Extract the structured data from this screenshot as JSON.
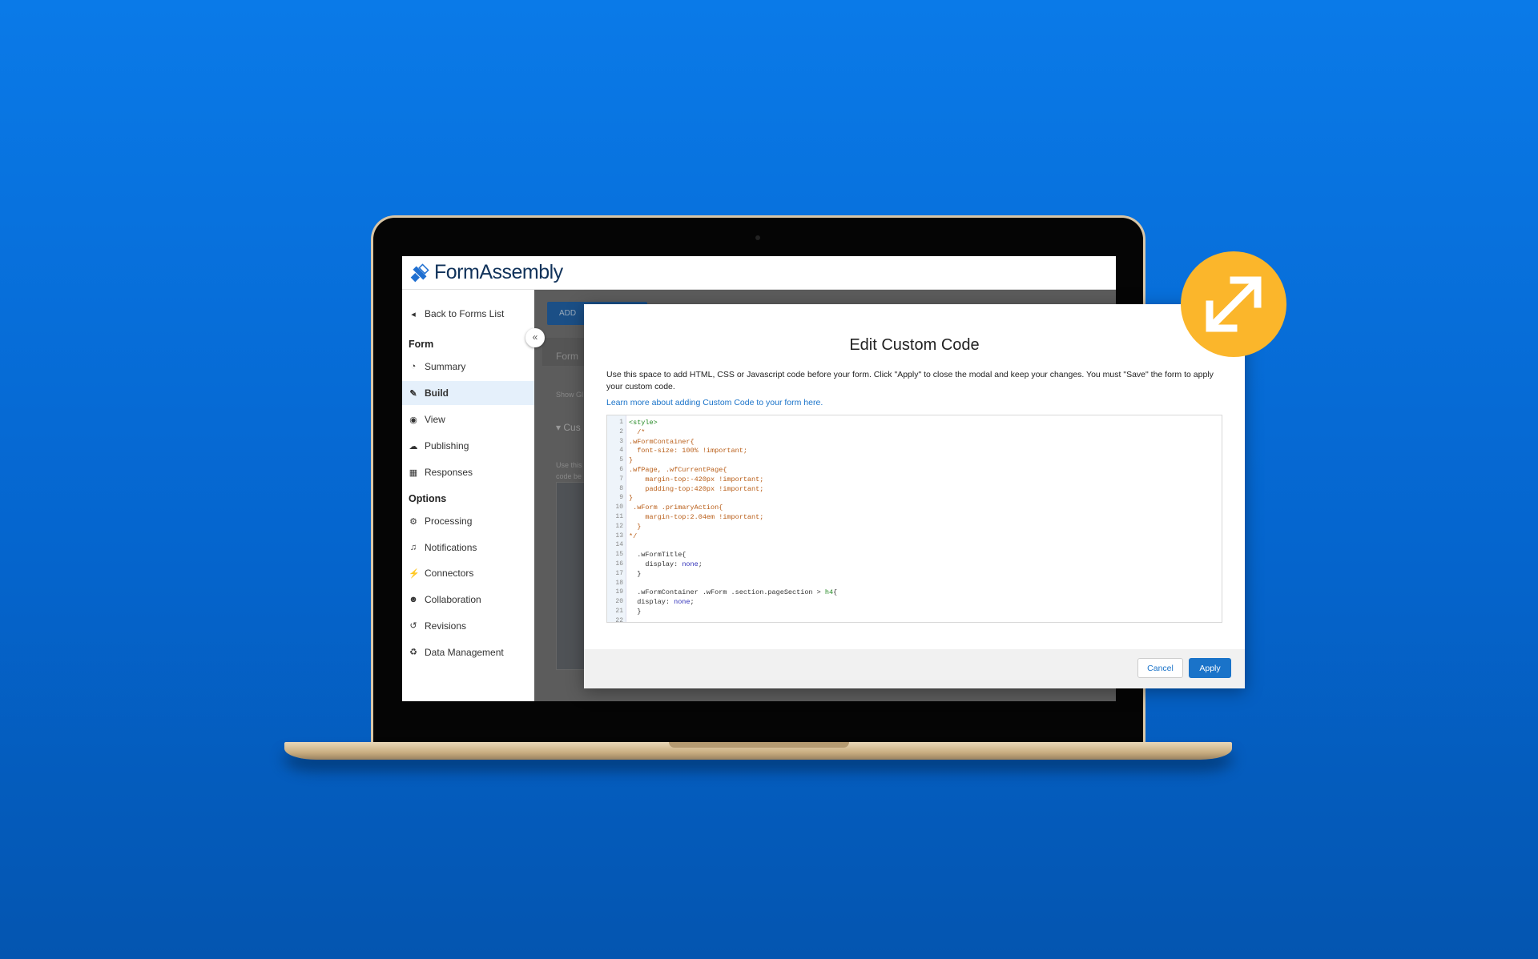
{
  "app": {
    "logo": "FormAssembly"
  },
  "sidebar": {
    "back": "Back to Forms List",
    "form_heading": "Form",
    "form_items": [
      {
        "label": "Summary",
        "icon": "dashboard-icon"
      },
      {
        "label": "Build",
        "icon": "pencil-icon",
        "active": true
      },
      {
        "label": "View",
        "icon": "eye-icon"
      },
      {
        "label": "Publishing",
        "icon": "cloud-upload-icon"
      },
      {
        "label": "Responses",
        "icon": "table-icon"
      }
    ],
    "options_heading": "Options",
    "option_items": [
      {
        "label": "Processing",
        "icon": "gears-icon"
      },
      {
        "label": "Notifications",
        "icon": "bell-icon"
      },
      {
        "label": "Connectors",
        "icon": "plug-icon"
      },
      {
        "label": "Collaboration",
        "icon": "users-icon"
      },
      {
        "label": "Revisions",
        "icon": "history-icon"
      },
      {
        "label": "Data Management",
        "icon": "recycle-icon"
      }
    ]
  },
  "background_page": {
    "add_button": "ADD",
    "form_label": "Form",
    "show": "Show Gl",
    "section": "Cus",
    "desc": "Use this code be"
  },
  "modal": {
    "title": "Edit Custom Code",
    "description": "Use this space to add HTML, CSS or Javascript code before your form. Click \"Apply\" to close the modal and keep your changes. You must \"Save\" the form to apply your custom code.",
    "link": "Learn more about adding Custom Code to your form here.",
    "code_lines": [
      "<style>",
      "  /*",
      ".wFormContainer{",
      "  font-size: 100% !important;",
      "}",
      ".wfPage, .wfCurrentPage{",
      "    margin-top:-420px !important;",
      "    padding-top:420px !important;",
      "}",
      " .wForm .primaryAction{",
      "    margin-top:2.04em !important;",
      "  }",
      "*/",
      "",
      "  .wFormTitle{",
      "    display: none;",
      "  }",
      "",
      "  .wFormContainer .wForm .section.pageSection > h4{",
      "  display: none;",
      "  }",
      ""
    ],
    "cancel": "Cancel",
    "apply": "Apply"
  },
  "colors": {
    "accent": "#1a73c9",
    "badge": "#fbb62b",
    "background": "#0a7ae8"
  },
  "badge_icon": "expand-arrows-icon"
}
